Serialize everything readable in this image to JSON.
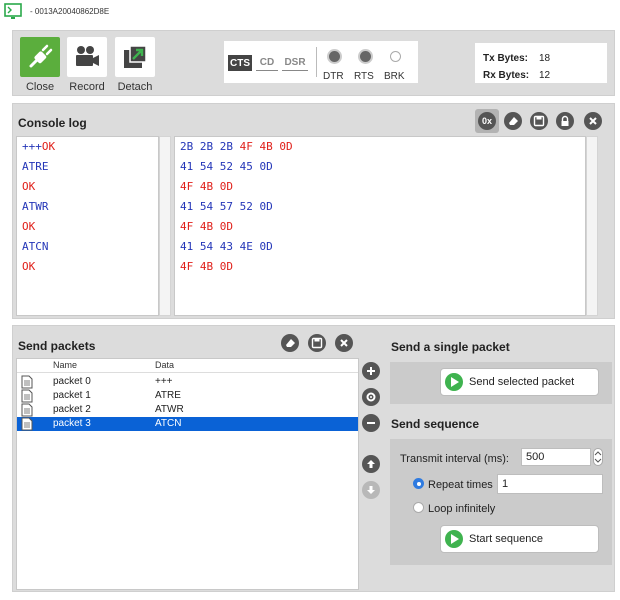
{
  "window": {
    "title": "- 0013A20040862D8E"
  },
  "toolbar": {
    "close_label": "Close",
    "record_label": "Record",
    "detach_label": "Detach",
    "lines": {
      "cts": "CTS",
      "cd": "CD",
      "dsr": "DSR"
    },
    "leds": {
      "dtr": "DTR",
      "rts": "RTS",
      "brk": "BRK"
    },
    "stats": {
      "tx_label": "Tx Bytes:",
      "tx_value": "18",
      "rx_label": "Rx Bytes:",
      "rx_value": "12"
    }
  },
  "console": {
    "title": "Console log",
    "hex_toggle_label": "0x",
    "rows": [
      {
        "ascii": "+++",
        "ascii_extra": "OK",
        "hex_sent": "2B 2B 2B ",
        "hex_recv": "4F 4B 0D"
      },
      {
        "ascii": "ATRE",
        "hex_sent": "41 54 52 45 0D",
        "dir": "sent"
      },
      {
        "ascii": "OK",
        "hex_recv": "4F 4B 0D",
        "dir": "recv"
      },
      {
        "ascii": "ATWR",
        "hex_sent": "41 54 57 52 0D",
        "dir": "sent"
      },
      {
        "ascii": "OK",
        "hex_recv": "4F 4B 0D",
        "dir": "recv"
      },
      {
        "ascii": "ATCN",
        "hex_sent": "41 54 43 4E 0D",
        "dir": "sent"
      },
      {
        "ascii": "OK",
        "hex_recv": "4F 4B 0D",
        "dir": "recv"
      }
    ],
    "colors": {
      "sent": "#2436b8",
      "recv": "#e0201a"
    }
  },
  "send_packets": {
    "title": "Send packets",
    "columns": {
      "name": "Name",
      "data": "Data"
    },
    "packets": [
      {
        "name": "packet 0",
        "data": "+++"
      },
      {
        "name": "packet 1",
        "data": "ATRE"
      },
      {
        "name": "packet 2",
        "data": "ATWR"
      },
      {
        "name": "packet 3",
        "data": "ATCN"
      }
    ],
    "selected_index": 3,
    "selection_color": "#0a62d6"
  },
  "single": {
    "title": "Send a single packet",
    "button_label": "Send selected packet"
  },
  "sequence": {
    "title": "Send sequence",
    "interval_label": "Transmit interval (ms):",
    "interval_value": "500",
    "repeat_label": "Repeat times",
    "repeat_value": "1",
    "loop_label": "Loop infinitely",
    "start_label": "Start sequence"
  }
}
